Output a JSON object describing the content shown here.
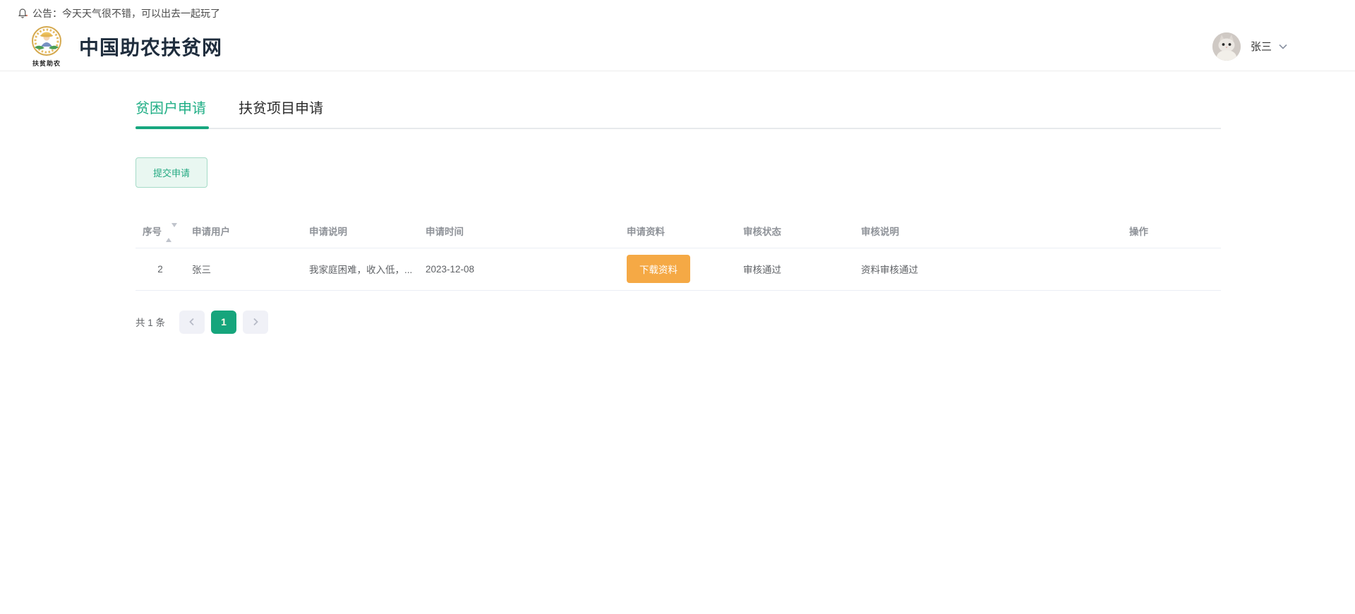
{
  "colors": {
    "accent_green": "#16a57c",
    "tab_active_green": "#1fae85",
    "warning_orange": "#f5a945",
    "table_header_gray": "#909399",
    "table_text_gray": "#606266"
  },
  "announcement": {
    "icon": "bell-icon",
    "text": "公告：今天天气很不错，可以出去一起玩了"
  },
  "header": {
    "logo_icon": "farmer-emblem-logo",
    "logo_caption": "扶贫助农",
    "site_title": "中国助农扶贫网",
    "username": "张三",
    "avatar_icon": "cat-avatar"
  },
  "tabs": [
    {
      "label": "贫困户申请",
      "active": true
    },
    {
      "label": "扶贫项目申请",
      "active": false
    }
  ],
  "toolbar": {
    "submit_label": "提交申请"
  },
  "table": {
    "columns": [
      "序号",
      "申请用户",
      "申请说明",
      "申请时间",
      "申请资料",
      "审核状态",
      "审核说明",
      "操作"
    ],
    "rows": [
      {
        "index": "2",
        "user": "张三",
        "description": "我家庭困难，收入低，...",
        "time": "2023-12-08",
        "material_button_label": "下载资料",
        "status": "审核通过",
        "review_note": "资料审核通过",
        "operation": ""
      }
    ]
  },
  "pagination": {
    "total_label": "共 1 条",
    "current_page": "1"
  }
}
